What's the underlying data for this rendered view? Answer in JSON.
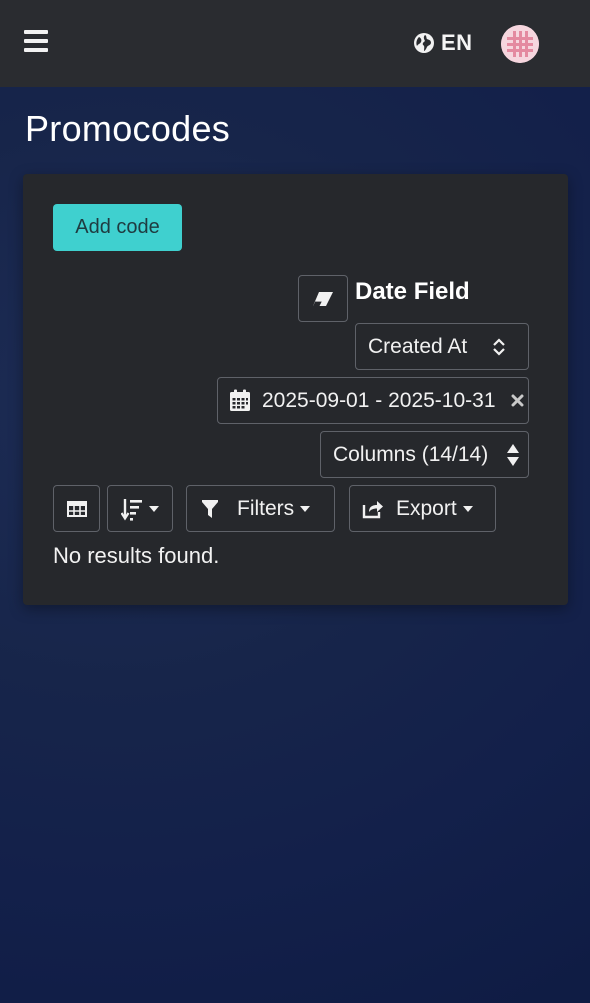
{
  "header": {
    "language": "EN"
  },
  "page": {
    "title": "Promocodes"
  },
  "card": {
    "add_button": "Add code",
    "date_field_label": "Date Field",
    "date_field_select": "Created At",
    "date_range": "2025-09-01 - 2025-10-31",
    "columns_select": "Columns (14/14)",
    "filters_label": "Filters",
    "export_label": "Export",
    "empty_message": "No results found."
  },
  "colors": {
    "accent": "#3fd0cf",
    "topbar": "#2a2c30",
    "card": "#26282c",
    "background": "#17254a"
  }
}
